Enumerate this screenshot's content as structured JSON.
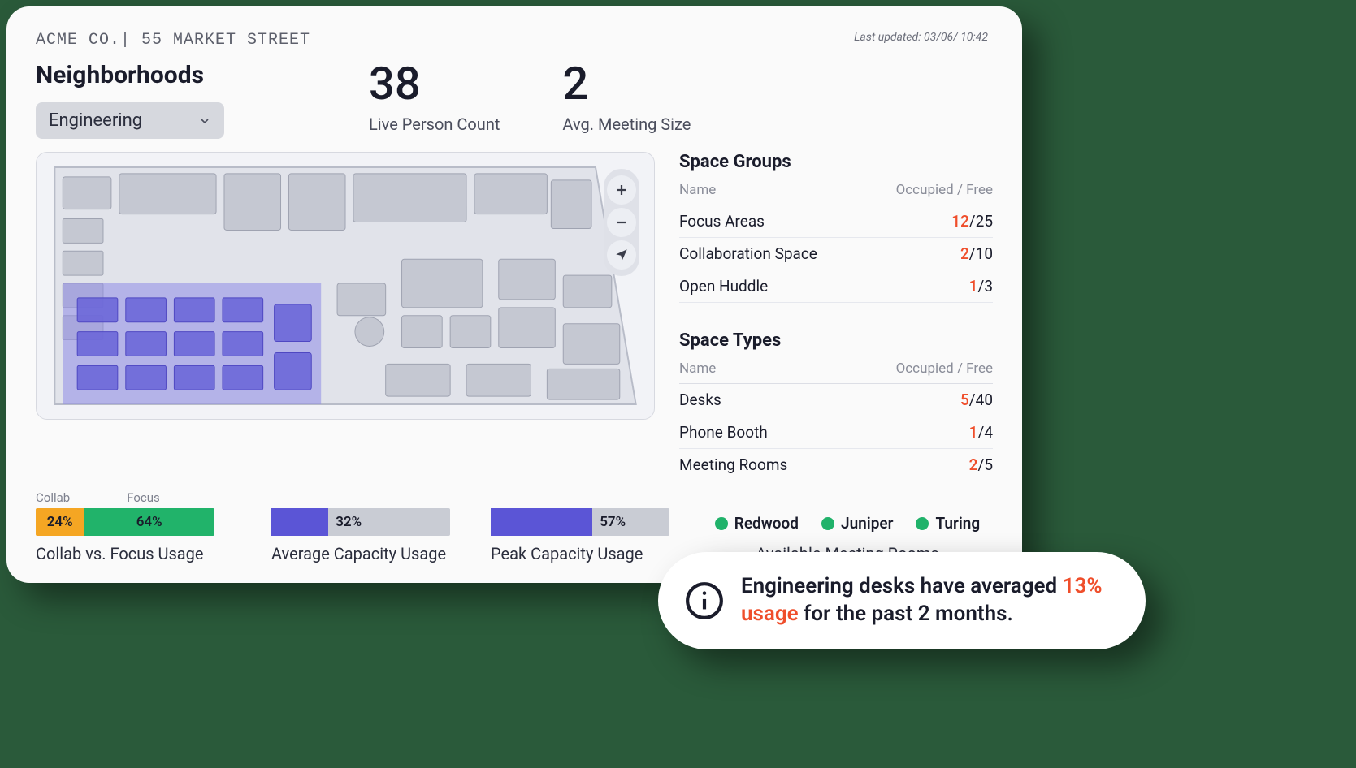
{
  "breadcrumb": "ACME CO.| 55 MARKET STREET",
  "last_updated": "Last updated: 03/06/ 10:42",
  "heading": "Neighborhoods",
  "select": {
    "value": "Engineering"
  },
  "metrics": {
    "live_count": {
      "value": "38",
      "label": "Live Person Count"
    },
    "avg_meeting": {
      "value": "2",
      "label": "Avg. Meeting Size"
    }
  },
  "space_groups": {
    "title": "Space Groups",
    "head_name": "Name",
    "head_of": "Occupied / Free",
    "rows": [
      {
        "name": "Focus Areas",
        "occupied": "12",
        "free": "25"
      },
      {
        "name": "Collaboration Space",
        "occupied": "2",
        "free": "10"
      },
      {
        "name": "Open Huddle",
        "occupied": "1",
        "free": "3"
      }
    ]
  },
  "space_types": {
    "title": "Space Types",
    "head_name": "Name",
    "head_of": "Occupied / Free",
    "rows": [
      {
        "name": "Desks",
        "occupied": "5",
        "free": "40"
      },
      {
        "name": "Phone Booth",
        "occupied": "1",
        "free": "4"
      },
      {
        "name": "Meeting Rooms",
        "occupied": "2",
        "free": "5"
      }
    ]
  },
  "charts": {
    "cvf": {
      "mini_collab": "Collab",
      "mini_focus": "Focus",
      "collab_pct": "24%",
      "focus_pct": "64%",
      "label": "Collab vs. Focus Usage"
    },
    "avg": {
      "pct": "32%",
      "label": "Average Capacity Usage"
    },
    "peak": {
      "pct": "57%",
      "label": "Peak Capacity Usage"
    }
  },
  "legend": {
    "items": [
      "Redwood",
      "Juniper",
      "Turing"
    ],
    "title": "Available Meeting Rooms"
  },
  "insight": {
    "pre": "Engineering desks have averaged ",
    "highlight": "13% usage",
    "post": " for the past 2 months."
  },
  "chart_data": [
    {
      "type": "bar",
      "title": "Collab vs. Focus Usage",
      "categories": [
        "Collab",
        "Focus"
      ],
      "values": [
        24,
        64
      ],
      "ylim": [
        0,
        100
      ],
      "ylabel": "%"
    },
    {
      "type": "bar",
      "title": "Average Capacity Usage",
      "categories": [
        "Average"
      ],
      "values": [
        32
      ],
      "ylim": [
        0,
        100
      ],
      "ylabel": "%"
    },
    {
      "type": "bar",
      "title": "Peak Capacity Usage",
      "categories": [
        "Peak"
      ],
      "values": [
        57
      ],
      "ylim": [
        0,
        100
      ],
      "ylabel": "%"
    },
    {
      "type": "table",
      "title": "Space Groups — Occupied / Free",
      "categories": [
        "Focus Areas",
        "Collaboration Space",
        "Open Huddle"
      ],
      "series": [
        {
          "name": "Occupied",
          "values": [
            12,
            2,
            1
          ]
        },
        {
          "name": "Free",
          "values": [
            25,
            10,
            3
          ]
        }
      ]
    },
    {
      "type": "table",
      "title": "Space Types — Occupied / Free",
      "categories": [
        "Desks",
        "Phone Booth",
        "Meeting Rooms"
      ],
      "series": [
        {
          "name": "Occupied",
          "values": [
            5,
            1,
            2
          ]
        },
        {
          "name": "Free",
          "values": [
            40,
            4,
            5
          ]
        }
      ]
    }
  ]
}
